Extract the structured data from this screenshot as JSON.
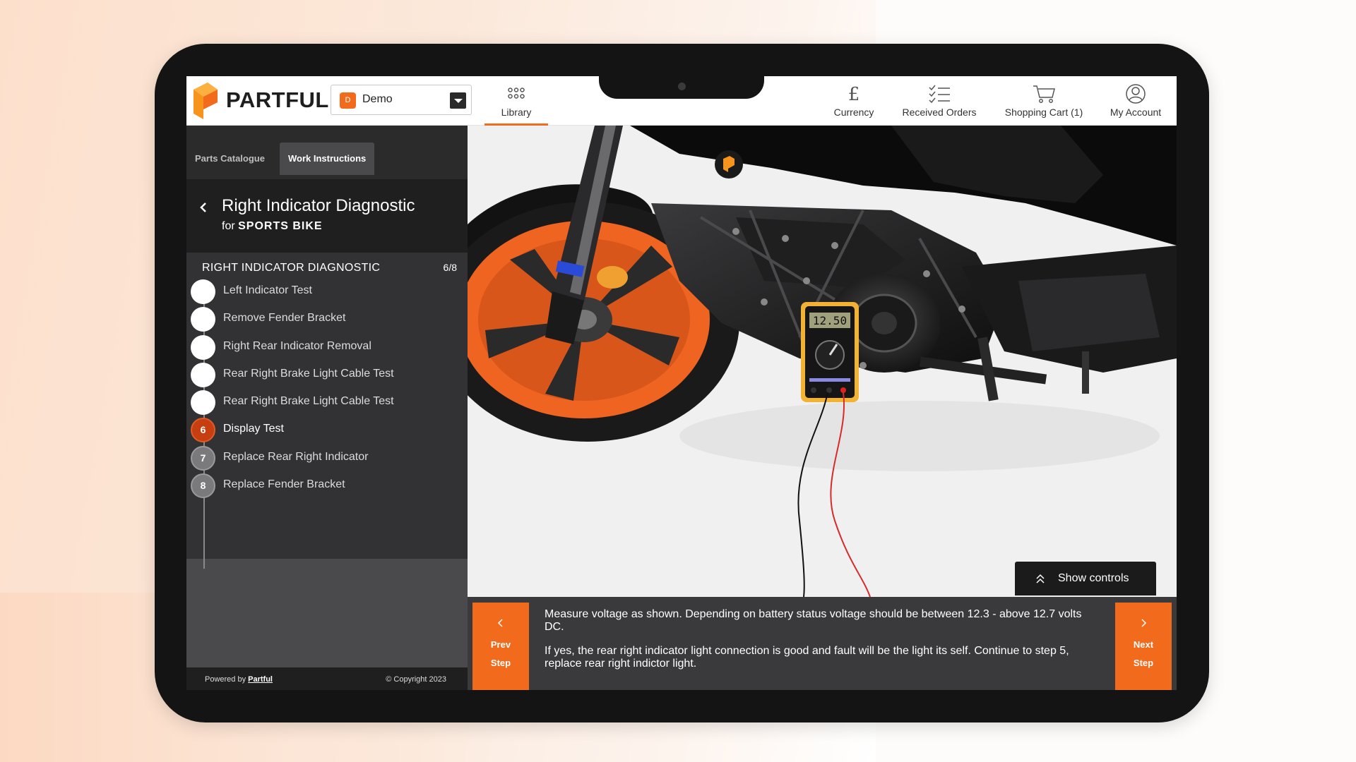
{
  "brand": {
    "name": "PARTFUL"
  },
  "project": {
    "badge": "D",
    "name": "Demo"
  },
  "nav": {
    "library": "Library",
    "currency": "Currency",
    "received_orders": "Received Orders",
    "shopping_cart": "Shopping Cart (1)",
    "my_account": "My Account"
  },
  "sidebar": {
    "tabs": [
      "Parts Catalogue",
      "Work Instructions"
    ],
    "active_tab": "Work Instructions",
    "procedure_title": "Right Indicator Diagnostic",
    "procedure_for": "for",
    "procedure_vehicle": "SPORTS BIKE",
    "steps_heading": "RIGHT INDICATOR DIAGNOSTIC",
    "steps_progress": "6/8",
    "steps": [
      {
        "number": "",
        "label": "Left Indicator Test",
        "state": "done"
      },
      {
        "number": "",
        "label": "Remove Fender Bracket",
        "state": "done"
      },
      {
        "number": "",
        "label": "Right Rear Indicator Removal",
        "state": "done"
      },
      {
        "number": "",
        "label": "Rear Right Brake Light Cable Test",
        "state": "done"
      },
      {
        "number": "",
        "label": "Rear Right Brake Light Cable Test",
        "state": "done"
      },
      {
        "number": "6",
        "label": "Display Test",
        "state": "active"
      },
      {
        "number": "7",
        "label": "Replace Rear Right Indicator",
        "state": "pending"
      },
      {
        "number": "8",
        "label": "Replace Fender Bracket",
        "state": "pending"
      }
    ],
    "footer_powered_prefix": "Powered by",
    "footer_powered_link": "Partful",
    "footer_copyright": "© Copyright 2023"
  },
  "viewer": {
    "multimeter_reading": "12.50",
    "show_controls": "Show controls"
  },
  "instructions": {
    "prev_line1": "Prev",
    "prev_line2": "Step",
    "next_line1": "Next",
    "next_line2": "Step",
    "paragraph1": "Measure voltage as shown. Depending on battery status voltage should be between 12.3 - above 12.7 volts DC.",
    "paragraph2": "If yes, the rear right indicator light connection is good and fault will be the light its self. Continue to step 5, replace rear right indictor light."
  },
  "colors": {
    "accent": "#f26b1d",
    "active_step": "#c73f10",
    "sidebar_dark": "#1f1f20",
    "sidebar_mid": "#323234",
    "wheel_orange": "#ee6420"
  }
}
